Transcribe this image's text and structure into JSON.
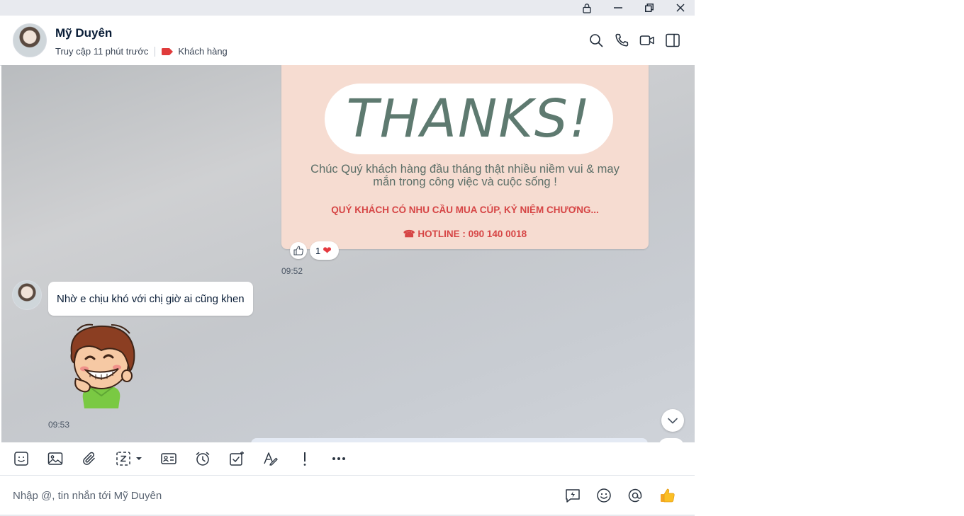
{
  "window": {
    "lock_icon": "lock-icon",
    "minimize_icon": "minimize-icon",
    "restore_icon": "restore-icon",
    "close_icon": "close-icon"
  },
  "header": {
    "contact_name": "Mỹ Duyên",
    "last_seen": "Truy cập 11 phút trước",
    "label": "Khách hàng",
    "label_color": "#e03b3b",
    "icons": [
      "search-icon",
      "phone-icon",
      "video-call-icon",
      "sidebar-toggle-icon"
    ]
  },
  "messages": {
    "image_card": {
      "headline": "THANKS!",
      "line1": "Chúc Quý khách hàng đầu tháng thật nhiều niềm vui & may",
      "line2": "mắn trong công việc và cuộc sống !",
      "promo": "QUÝ KHÁCH CÓ NHU CẦU MUA CÚP, KỶ NIỆM CHƯƠNG...",
      "hotline": "☎ HOTLINE : 090 140 0018",
      "reaction_count": "1",
      "reaction_heart": "❤",
      "time": "09:52"
    },
    "text_message": {
      "text": "Nhờ e chịu khó với chị giờ ai cũng khen"
    },
    "sticker": {
      "name": "laughing-boy-sticker",
      "time": "09:53"
    }
  },
  "toolbar": {
    "icons": [
      "sticker-icon",
      "image-icon",
      "attachment-icon",
      "screenshot-icon",
      "contact-card-icon",
      "reminder-icon",
      "task-icon",
      "text-format-icon",
      "important-icon",
      "more-icon"
    ]
  },
  "composer": {
    "placeholder": "Nhập @, tin nhắn tới Mỹ Duyên",
    "value": "",
    "icons": [
      "quick-message-icon",
      "emoji-icon",
      "mention-icon",
      "thumbs-up-icon"
    ]
  },
  "colors": {
    "accent_red": "#d64545",
    "card_bg": "#f6dcd1",
    "card_text": "#5e7a70"
  }
}
